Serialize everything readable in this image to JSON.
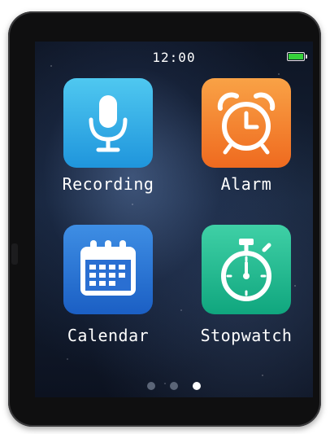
{
  "status_bar": {
    "time": "12:00",
    "battery_level": 1.0,
    "battery_color": "#35d13a"
  },
  "apps": [
    {
      "label": "Recording",
      "icon": "microphone-icon",
      "color_top": "#4fc8f0",
      "color_bottom": "#1f95dc"
    },
    {
      "label": "Alarm",
      "icon": "alarm-clock-icon",
      "color_top": "#f9a246",
      "color_bottom": "#ef6a1f"
    },
    {
      "label": "Calendar",
      "icon": "calendar-icon",
      "color_top": "#3e8ee4",
      "color_bottom": "#1b5fc4"
    },
    {
      "label": "Stopwatch",
      "icon": "stopwatch-icon",
      "color_top": "#3fd0a6",
      "color_bottom": "#10a67e"
    }
  ],
  "pager": {
    "pages": 3,
    "current_page": 3
  }
}
